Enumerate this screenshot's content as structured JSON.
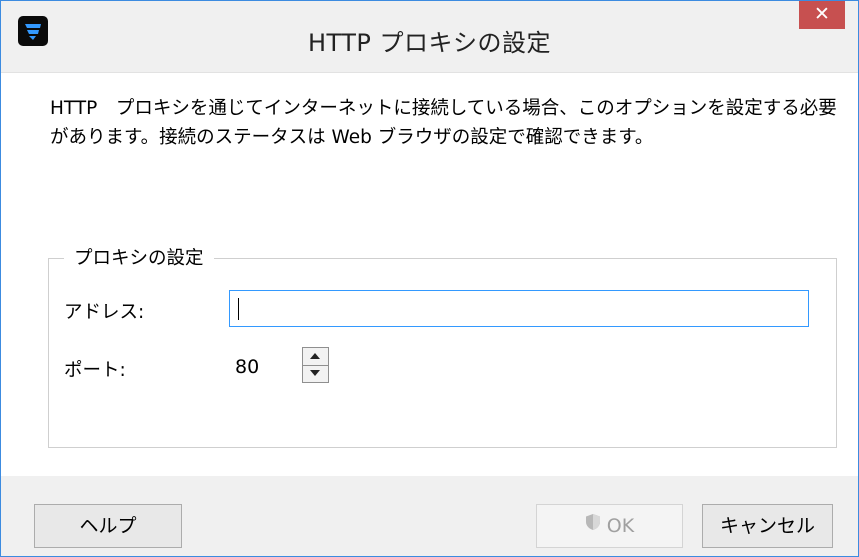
{
  "window": {
    "title": "HTTP プロキシの設定",
    "close_label": "✕"
  },
  "description": {
    "text": "HTTP　プロキシを通じてインターネットに接続している場合、このオプションを設定する必要があります。接続のステータスは Web ブラウザの設定で確認できます。"
  },
  "proxy_group": {
    "legend": "プロキシの設定",
    "address_label": "アドレス:",
    "address_value": "",
    "port_label": "ポート:",
    "port_value": "80"
  },
  "buttons": {
    "help": "ヘルプ",
    "ok": "OK",
    "cancel": "キャンセル"
  },
  "colors": {
    "accent": "#3399ff",
    "close": "#c75050",
    "disabled_text": "#a0a0a0"
  }
}
